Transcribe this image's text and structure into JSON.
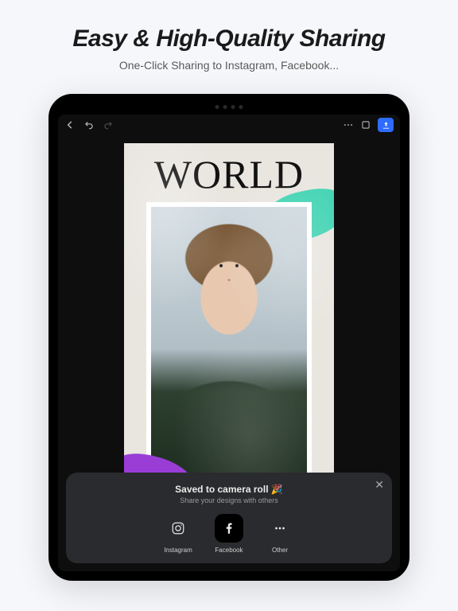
{
  "marketing": {
    "headline": "Easy & High-Quality Sharing",
    "subhead": "One-Click Sharing to Instagram, Facebook..."
  },
  "editor": {
    "poster_title": "WORLD"
  },
  "share_sheet": {
    "title": "Saved to camera roll 🎉",
    "subtitle": "Share your designs with others",
    "items": [
      {
        "label": "Instagram"
      },
      {
        "label": "Facebook"
      },
      {
        "label": "Other"
      }
    ]
  }
}
